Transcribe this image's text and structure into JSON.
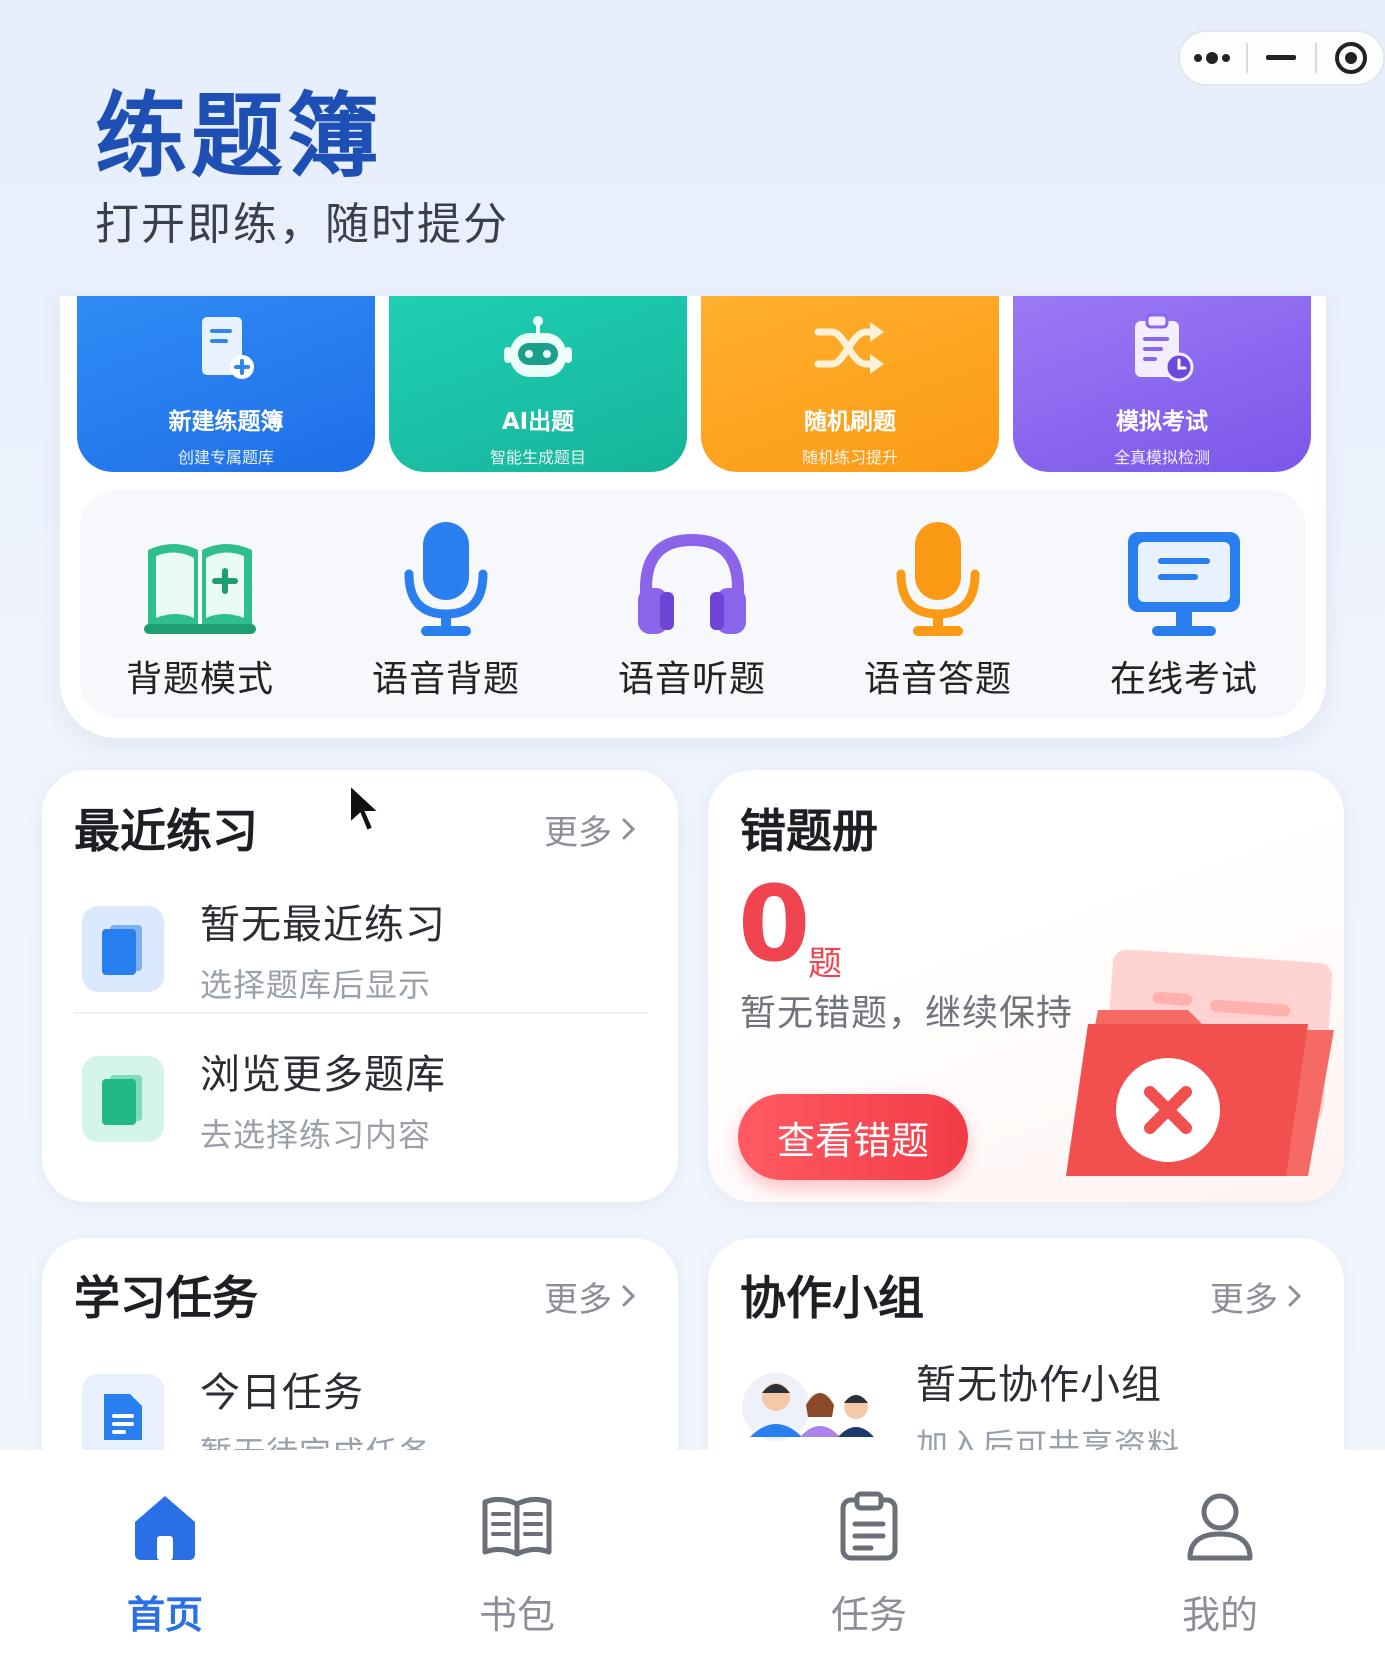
{
  "header": {
    "title": "练题簿",
    "subtitle": "打开即练，随时提分"
  },
  "capsule": {
    "icons": [
      "more-dots-icon",
      "minimize-icon",
      "target-close-icon"
    ]
  },
  "feature_cards": [
    {
      "title": "新建练题簿",
      "sub": "创建专属题库",
      "icon": "new-notebook-icon",
      "color": "#2a80f0"
    },
    {
      "title": "AI出题",
      "sub": "智能生成题目",
      "icon": "robot-icon",
      "color": "#1bc2a7"
    },
    {
      "title": "随机刷题",
      "sub": "随机练习提升",
      "icon": "shuffle-icon",
      "color": "#fca521"
    },
    {
      "title": "模拟考试",
      "sub": "全真模拟检测",
      "icon": "exam-clipboard-icon",
      "color": "#8a66ef"
    }
  ],
  "quick_actions": [
    {
      "label": "背题模式",
      "icon": "book-plus-icon"
    },
    {
      "label": "语音背题",
      "icon": "microphone-blue-icon"
    },
    {
      "label": "语音听题",
      "icon": "headphones-icon"
    },
    {
      "label": "语音答题",
      "icon": "microphone-orange-icon"
    },
    {
      "label": "在线考试",
      "icon": "monitor-icon"
    }
  ],
  "recent": {
    "title": "最近练习",
    "more": "更多",
    "items": [
      {
        "main": "暂无最近练习",
        "sub": "选择题库后显示"
      },
      {
        "main": "浏览更多题库",
        "sub": "去选择练习内容"
      }
    ]
  },
  "wrong": {
    "title": "错题册",
    "count": "0",
    "unit": "题",
    "hint": "暂无错题，继续保持",
    "button": "查看错题"
  },
  "tasks": {
    "title": "学习任务",
    "more": "更多",
    "item": {
      "main": "今日任务",
      "sub": "暂无待完成任务"
    }
  },
  "groups": {
    "title": "协作小组",
    "more": "更多",
    "item": {
      "main": "暂无协作小组",
      "sub": "加入后可共享资料"
    }
  },
  "tabbar": [
    {
      "label": "首页",
      "icon": "home-icon",
      "active": true
    },
    {
      "label": "书包",
      "icon": "open-book-icon",
      "active": false
    },
    {
      "label": "任务",
      "icon": "clipboard-icon",
      "active": false
    },
    {
      "label": "我的",
      "icon": "user-icon",
      "active": false
    }
  ],
  "colors": {
    "accent": "#2a6fe6",
    "title": "#1e4fb4",
    "danger": "#f04550"
  }
}
